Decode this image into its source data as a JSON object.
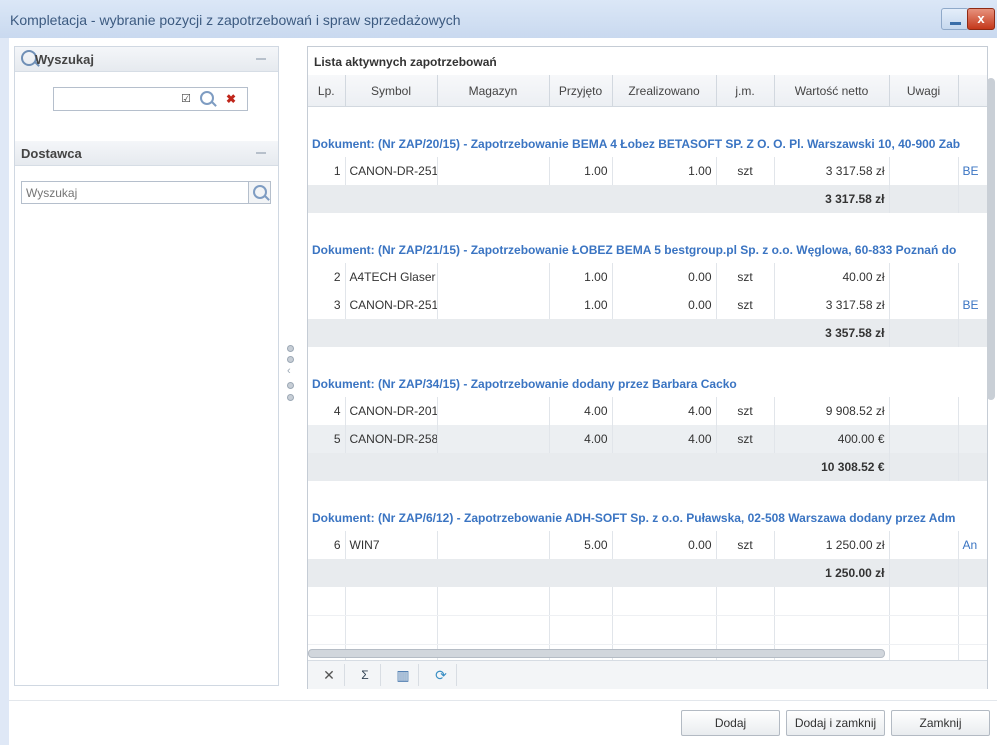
{
  "window": {
    "title": "Kompletacja - wybranie pozycji z zapotrzebowań i spraw sprzedażowych",
    "close_label": "x"
  },
  "left": {
    "search_panel_title": "Wyszukaj",
    "search_value": "",
    "supplier_panel_title": "Dostawca",
    "supplier_placeholder": "Wyszukaj"
  },
  "grid": {
    "title": "Lista aktywnych zapotrzebowań",
    "columns": [
      "Lp.",
      "Symbol",
      "Magazyn",
      "Przyjęto",
      "Zrealizowano",
      "j.m.",
      "Wartość netto",
      "Uwagi"
    ],
    "groups": [
      {
        "header": "Dokument: (Nr ZAP/20/15) - Zapotrzebowanie BEMA 4 Łobez BETASOFT SP. Z O. O. Pl. Warszawski 10, 40-900 Zab",
        "rows": [
          {
            "lp": "1",
            "symbol": "CANON-DR-251",
            "magazyn": "",
            "przyjeto": "1.00",
            "zrealizowano": "1.00",
            "jm": "szt",
            "wartosc": "3 317.58 zł",
            "uwagi": "BE"
          }
        ],
        "total": "3 317.58 zł"
      },
      {
        "header": "Dokument: (Nr ZAP/21/15) - Zapotrzebowanie ŁOBEZ BEMA 5 bestgroup.pl Sp. z o.o. Węglowa, 60-833 Poznań do",
        "rows": [
          {
            "lp": "2",
            "symbol": "A4TECH Glaser",
            "magazyn": "",
            "przyjeto": "1.00",
            "zrealizowano": "0.00",
            "jm": "szt",
            "wartosc": "40.00 zł",
            "uwagi": ""
          },
          {
            "lp": "3",
            "symbol": "CANON-DR-251",
            "magazyn": "",
            "przyjeto": "1.00",
            "zrealizowano": "0.00",
            "jm": "szt",
            "wartosc": "3 317.58 zł",
            "uwagi": "BE"
          }
        ],
        "total": "3 357.58 zł"
      },
      {
        "header": "Dokument: (Nr ZAP/34/15) - Zapotrzebowanie dodany przez Barbara Cacko",
        "rows": [
          {
            "lp": "4",
            "symbol": "CANON-DR-201",
            "magazyn": "",
            "przyjeto": "4.00",
            "zrealizowano": "4.00",
            "jm": "szt",
            "wartosc": "9 908.52 zł",
            "uwagi": ""
          },
          {
            "lp": "5",
            "symbol": "CANON-DR-258",
            "magazyn": "",
            "przyjeto": "4.00",
            "zrealizowano": "4.00",
            "jm": "szt",
            "wartosc": "400.00 €",
            "uwagi": ""
          }
        ],
        "total": "10 308.52 €"
      },
      {
        "header": "Dokument: (Nr ZAP/6/12) - Zapotrzebowanie ADH-SOFT Sp. z o.o. Puławska, 02-508 Warszawa dodany przez Adm",
        "rows": [
          {
            "lp": "6",
            "symbol": "WIN7",
            "magazyn": "",
            "przyjeto": "5.00",
            "zrealizowano": "0.00",
            "jm": "szt",
            "wartosc": "1 250.00 zł",
            "uwagi": "An"
          }
        ],
        "total": "1 250.00 zł"
      }
    ]
  },
  "buttons": {
    "add": "Dodaj",
    "add_close": "Dodaj i zamknij",
    "close": "Zamknij"
  }
}
